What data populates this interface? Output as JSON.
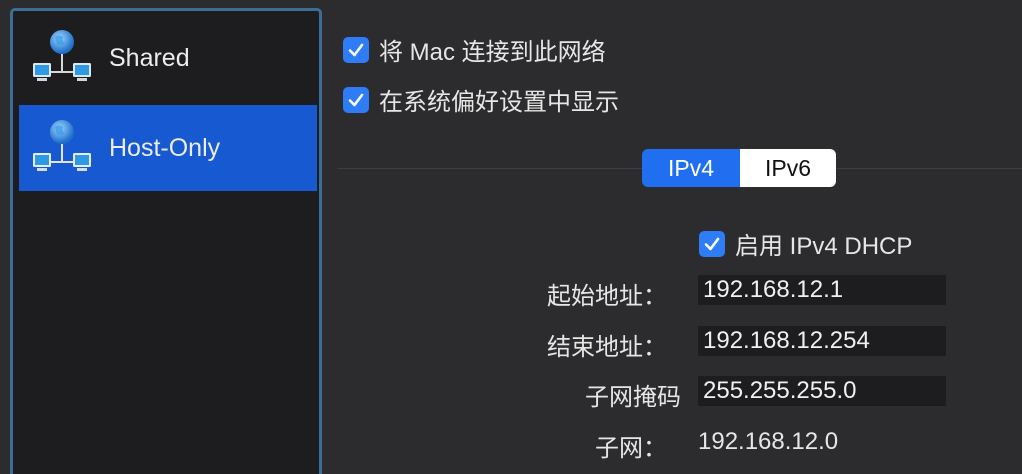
{
  "sidebar": {
    "items": [
      {
        "label": "Shared",
        "icon": "network-globe-icon",
        "selected": false
      },
      {
        "label": "Host-Only",
        "icon": "network-globe-icon",
        "selected": true
      }
    ]
  },
  "options": {
    "connect_mac": {
      "label": "将 Mac 连接到此网络",
      "checked": true
    },
    "show_in_prefs": {
      "label": "在系统偏好设置中显示",
      "checked": true
    }
  },
  "segmented": {
    "ipv4": "IPv4",
    "ipv6": "IPv6",
    "selected": "IPv4"
  },
  "dhcp": {
    "enable_label": "启用 IPv4 DHCP",
    "checked": true
  },
  "form": {
    "start_label": "起始地址：",
    "start_value": "192.168.12.1",
    "end_label": "结束地址：",
    "end_value": "192.168.12.254",
    "mask_label": "子网掩码",
    "mask_value": "255.255.255.0",
    "subnet_label": "子网：",
    "subnet_value": "192.168.12.0"
  },
  "colors": {
    "accent": "#1f6ff0",
    "selection": "#1659d0",
    "sidebar_border": "#3c6e95",
    "background": "#2c2c2e"
  }
}
